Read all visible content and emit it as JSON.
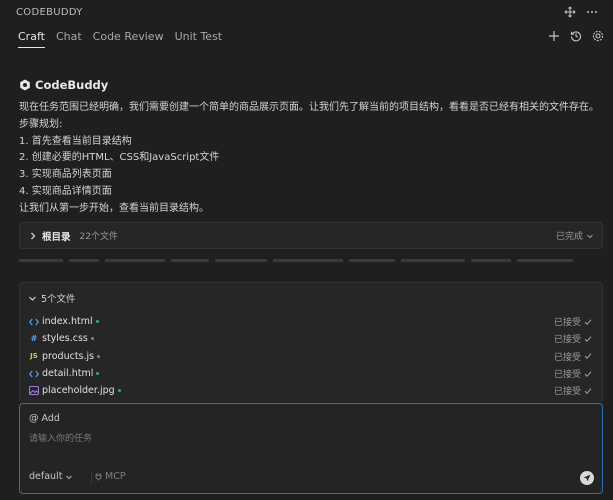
{
  "window": {
    "title": "CODEBUDDY"
  },
  "tabs": [
    {
      "label": "Craft"
    },
    {
      "label": "Chat"
    },
    {
      "label": "Code Review"
    },
    {
      "label": "Unit Test"
    }
  ],
  "assistant": {
    "name": "CodeBuddy"
  },
  "message": {
    "lines": [
      "现在任务范围已经明确，我们需要创建一个简单的商品展示页面。让我们先了解当前的项目结构，看看是否已经有相关的文件存在。",
      "步骤规划:",
      "1. 首先查看当前目录结构",
      "2. 创建必要的HTML、CSS和JavaScript文件",
      "3. 实现商品列表页面",
      "4. 实现商品详情页面",
      "让我们从第一步开始，查看当前目录结构。"
    ]
  },
  "dir_card": {
    "label": "根目录",
    "count": "22个文件",
    "status": "已完成"
  },
  "files_card": {
    "label": "5个文件",
    "files": [
      {
        "name": "index.html",
        "icon": "code-icon",
        "status": "已接受"
      },
      {
        "name": "styles.css",
        "icon": "hash-icon",
        "status": "已接受"
      },
      {
        "name": "products.js",
        "icon": "js-icon",
        "status": "已接受"
      },
      {
        "name": "detail.html",
        "icon": "code-icon",
        "status": "已接受"
      },
      {
        "name": "placeholder.jpg",
        "icon": "image-icon",
        "status": "已接受"
      }
    ]
  },
  "input": {
    "add_label": "@ Add",
    "placeholder": "请输入你的任务",
    "model": "default",
    "mcp_label": "MCP"
  },
  "icons": {
    "js": "JS",
    "hash": "#"
  },
  "colors": {
    "accent": "#2f6fb7",
    "js": "#e5c038",
    "code": "#5aa2e8",
    "image": "#a779d6",
    "dot": "#3fa86b"
  }
}
